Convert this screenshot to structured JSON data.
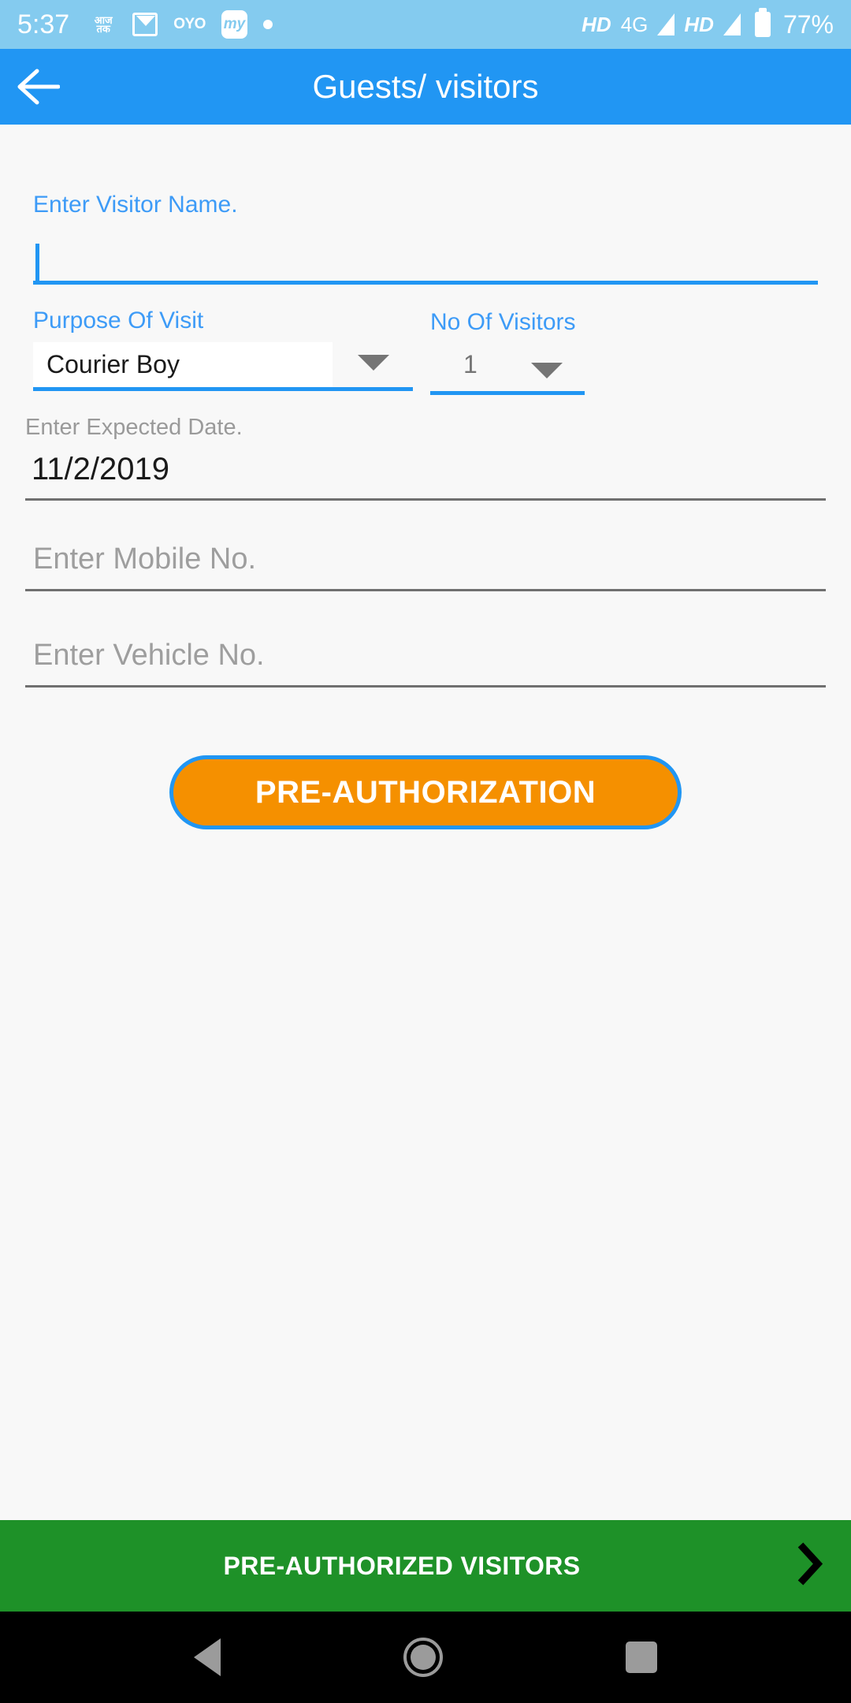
{
  "status_bar": {
    "time": "5:37",
    "battery_percent": "77%",
    "network_hd_1": "HD",
    "network_4g": "4G",
    "network_hd_2": "HD",
    "app_icons": [
      "aajtak-icon",
      "gmail-icon",
      "oyo-icon",
      "my-icon",
      "dot-icon"
    ],
    "background_color": "#84CBEF"
  },
  "appbar": {
    "title": "Guests/ visitors",
    "back_icon": "arrow-left-icon",
    "background_color": "#2196F3"
  },
  "form": {
    "visitor_name": {
      "label": "Enter Visitor Name.",
      "value": "",
      "placeholder": ""
    },
    "purpose_of_visit": {
      "label": "Purpose Of Visit",
      "selected": "Courier Boy",
      "dropdown_icon": "chevron-down-icon"
    },
    "no_of_visitors": {
      "label": "No Of Visitors",
      "selected": "1",
      "dropdown_icon": "chevron-down-icon"
    },
    "expected_date": {
      "label": "Enter Expected Date.",
      "value": "11/2/2019"
    },
    "mobile_no": {
      "placeholder": "Enter  Mobile No.",
      "value": ""
    },
    "vehicle_no": {
      "placeholder": "Enter Vehicle No.",
      "value": ""
    },
    "submit_button": {
      "label": "PRE-AUTHORIZATION",
      "fill_color": "#F59000",
      "border_color": "#2196F3"
    }
  },
  "footer": {
    "label": "PRE-AUTHORIZED VISITORS",
    "chevron_icon": "chevron-right-icon",
    "background_color": "#1E9128"
  },
  "nav_bar": {
    "back": "triangle-back-icon",
    "home": "circle-home-icon",
    "recents": "square-recents-icon"
  }
}
